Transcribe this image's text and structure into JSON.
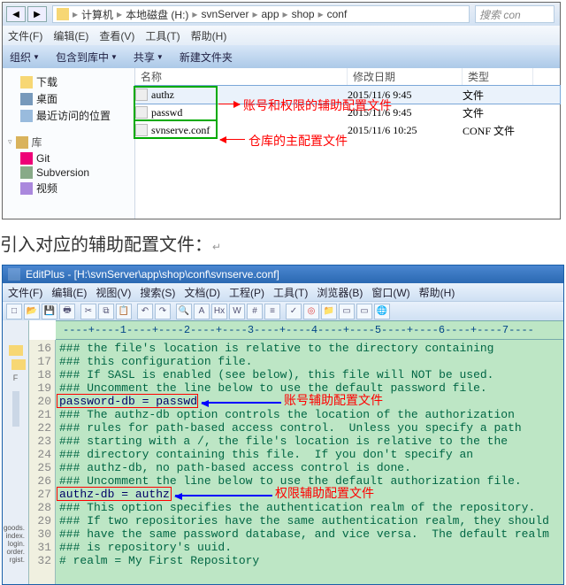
{
  "explorer": {
    "back_label": "◀",
    "fwd_label": "▶",
    "crumbs": [
      "计算机",
      "本地磁盘 (H:)",
      "svnServer",
      "app",
      "shop",
      "conf"
    ],
    "search_placeholder": "搜索 con",
    "menu": {
      "file": "文件(F)",
      "edit": "编辑(E)",
      "view": "查看(V)",
      "tools": "工具(T)",
      "help": "帮助(H)"
    },
    "tool": {
      "org": "组织",
      "include": "包含到库中",
      "share": "共享",
      "newfolder": "新建文件夹"
    },
    "tree": {
      "fav_hdr": "下载",
      "desktop": "桌面",
      "recent": "最近访问的位置",
      "lib_hdr": "库",
      "git": "Git",
      "svn": "Subversion",
      "video": "视频"
    },
    "cols": {
      "name": "名称",
      "date": "修改日期",
      "type": "类型"
    },
    "rows": [
      {
        "name": "authz",
        "date": "2015/11/6 9:45",
        "type": "文件"
      },
      {
        "name": "passwd",
        "date": "2015/11/6 9:45",
        "type": "文件"
      },
      {
        "name": "svnserve.conf",
        "date": "2015/11/6 10:25",
        "type": "CONF 文件"
      }
    ],
    "ann_accounts": "账号和权限的辅助配置文件",
    "ann_repo": "仓库的主配置文件"
  },
  "caption": "引入对应的辅助配置文件：",
  "editor": {
    "title": "EditPlus - [H:\\svnServer\\app\\shop\\conf\\svnserve.conf]",
    "menu": {
      "file": "文件(F)",
      "edit": "编辑(E)",
      "view": "视图(V)",
      "search": "搜索(S)",
      "doc": "文档(D)",
      "proj": "工程(P)",
      "tools": "工具(T)",
      "browser": "浏览器(B)",
      "window": "窗口(W)",
      "help": "帮助(H)"
    },
    "gutter_start": 16,
    "gutter_end": 32,
    "code_lines": [
      "### the file's location is relative to the directory containing",
      "### this configuration file.",
      "### If SASL is enabled (see below), this file will NOT be used.",
      "### Uncomment the line below to use the default password file.",
      "password-db = passwd",
      "### The authz-db option controls the location of the authorization",
      "### rules for path-based access control.  Unless you specify a path",
      "### starting with a /, the file's location is relative to the the",
      "### directory containing this file.  If you don't specify an",
      "### authz-db, no path-based access control is done.",
      "### Uncomment the line below to use the default authorization file.",
      "authz-db = authz",
      "### This option specifies the authentication realm of the repository.",
      "### If two repositories have the same authentication realm, they should",
      "### have the same password database, and vice versa.  The default realm",
      "### is repository's uuid.",
      "# realm = My First Repository"
    ],
    "ann_pwd": "账号辅助配置文件",
    "ann_authz": "权限辅助配置文件",
    "dir_items": [
      "goods.",
      "index.",
      "login.",
      "order.",
      "rgist."
    ]
  }
}
